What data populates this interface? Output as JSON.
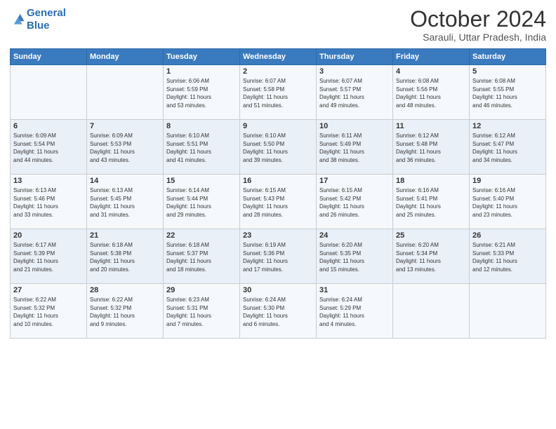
{
  "logo": {
    "line1": "General",
    "line2": "Blue"
  },
  "title": "October 2024",
  "location": "Sarauli, Uttar Pradesh, India",
  "days_of_week": [
    "Sunday",
    "Monday",
    "Tuesday",
    "Wednesday",
    "Thursday",
    "Friday",
    "Saturday"
  ],
  "weeks": [
    [
      {
        "day": "",
        "info": ""
      },
      {
        "day": "",
        "info": ""
      },
      {
        "day": "1",
        "info": "Sunrise: 6:06 AM\nSunset: 5:59 PM\nDaylight: 11 hours\nand 53 minutes."
      },
      {
        "day": "2",
        "info": "Sunrise: 6:07 AM\nSunset: 5:58 PM\nDaylight: 11 hours\nand 51 minutes."
      },
      {
        "day": "3",
        "info": "Sunrise: 6:07 AM\nSunset: 5:57 PM\nDaylight: 11 hours\nand 49 minutes."
      },
      {
        "day": "4",
        "info": "Sunrise: 6:08 AM\nSunset: 5:56 PM\nDaylight: 11 hours\nand 48 minutes."
      },
      {
        "day": "5",
        "info": "Sunrise: 6:08 AM\nSunset: 5:55 PM\nDaylight: 11 hours\nand 46 minutes."
      }
    ],
    [
      {
        "day": "6",
        "info": "Sunrise: 6:09 AM\nSunset: 5:54 PM\nDaylight: 11 hours\nand 44 minutes."
      },
      {
        "day": "7",
        "info": "Sunrise: 6:09 AM\nSunset: 5:53 PM\nDaylight: 11 hours\nand 43 minutes."
      },
      {
        "day": "8",
        "info": "Sunrise: 6:10 AM\nSunset: 5:51 PM\nDaylight: 11 hours\nand 41 minutes."
      },
      {
        "day": "9",
        "info": "Sunrise: 6:10 AM\nSunset: 5:50 PM\nDaylight: 11 hours\nand 39 minutes."
      },
      {
        "day": "10",
        "info": "Sunrise: 6:11 AM\nSunset: 5:49 PM\nDaylight: 11 hours\nand 38 minutes."
      },
      {
        "day": "11",
        "info": "Sunrise: 6:12 AM\nSunset: 5:48 PM\nDaylight: 11 hours\nand 36 minutes."
      },
      {
        "day": "12",
        "info": "Sunrise: 6:12 AM\nSunset: 5:47 PM\nDaylight: 11 hours\nand 34 minutes."
      }
    ],
    [
      {
        "day": "13",
        "info": "Sunrise: 6:13 AM\nSunset: 5:46 PM\nDaylight: 11 hours\nand 33 minutes."
      },
      {
        "day": "14",
        "info": "Sunrise: 6:13 AM\nSunset: 5:45 PM\nDaylight: 11 hours\nand 31 minutes."
      },
      {
        "day": "15",
        "info": "Sunrise: 6:14 AM\nSunset: 5:44 PM\nDaylight: 11 hours\nand 29 minutes."
      },
      {
        "day": "16",
        "info": "Sunrise: 6:15 AM\nSunset: 5:43 PM\nDaylight: 11 hours\nand 28 minutes."
      },
      {
        "day": "17",
        "info": "Sunrise: 6:15 AM\nSunset: 5:42 PM\nDaylight: 11 hours\nand 26 minutes."
      },
      {
        "day": "18",
        "info": "Sunrise: 6:16 AM\nSunset: 5:41 PM\nDaylight: 11 hours\nand 25 minutes."
      },
      {
        "day": "19",
        "info": "Sunrise: 6:16 AM\nSunset: 5:40 PM\nDaylight: 11 hours\nand 23 minutes."
      }
    ],
    [
      {
        "day": "20",
        "info": "Sunrise: 6:17 AM\nSunset: 5:39 PM\nDaylight: 11 hours\nand 21 minutes."
      },
      {
        "day": "21",
        "info": "Sunrise: 6:18 AM\nSunset: 5:38 PM\nDaylight: 11 hours\nand 20 minutes."
      },
      {
        "day": "22",
        "info": "Sunrise: 6:18 AM\nSunset: 5:37 PM\nDaylight: 11 hours\nand 18 minutes."
      },
      {
        "day": "23",
        "info": "Sunrise: 6:19 AM\nSunset: 5:36 PM\nDaylight: 11 hours\nand 17 minutes."
      },
      {
        "day": "24",
        "info": "Sunrise: 6:20 AM\nSunset: 5:35 PM\nDaylight: 11 hours\nand 15 minutes."
      },
      {
        "day": "25",
        "info": "Sunrise: 6:20 AM\nSunset: 5:34 PM\nDaylight: 11 hours\nand 13 minutes."
      },
      {
        "day": "26",
        "info": "Sunrise: 6:21 AM\nSunset: 5:33 PM\nDaylight: 11 hours\nand 12 minutes."
      }
    ],
    [
      {
        "day": "27",
        "info": "Sunrise: 6:22 AM\nSunset: 5:32 PM\nDaylight: 11 hours\nand 10 minutes."
      },
      {
        "day": "28",
        "info": "Sunrise: 6:22 AM\nSunset: 5:32 PM\nDaylight: 11 hours\nand 9 minutes."
      },
      {
        "day": "29",
        "info": "Sunrise: 6:23 AM\nSunset: 5:31 PM\nDaylight: 11 hours\nand 7 minutes."
      },
      {
        "day": "30",
        "info": "Sunrise: 6:24 AM\nSunset: 5:30 PM\nDaylight: 11 hours\nand 6 minutes."
      },
      {
        "day": "31",
        "info": "Sunrise: 6:24 AM\nSunset: 5:29 PM\nDaylight: 11 hours\nand 4 minutes."
      },
      {
        "day": "",
        "info": ""
      },
      {
        "day": "",
        "info": ""
      }
    ]
  ]
}
